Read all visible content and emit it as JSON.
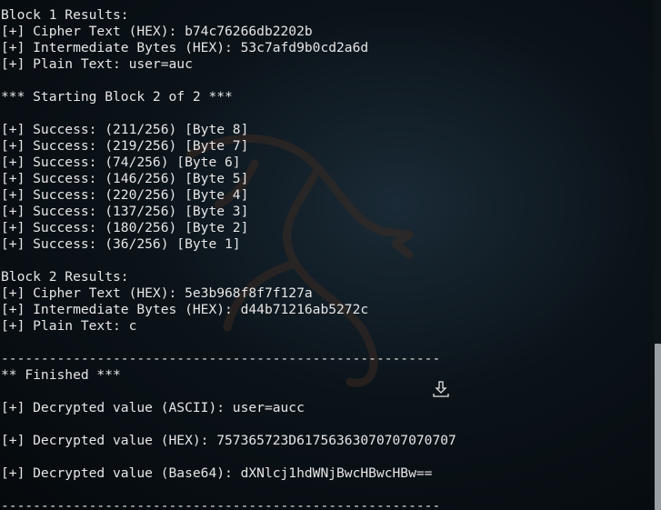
{
  "terminal": {
    "lines": [
      "Block 1 Results:",
      "[+] Cipher Text (HEX): b74c76266db2202b",
      "[+] Intermediate Bytes (HEX): 53c7afd9b0cd2a6d",
      "[+] Plain Text: user=auc",
      "",
      "*** Starting Block 2 of 2 ***",
      "",
      "[+] Success: (211/256) [Byte 8]",
      "[+] Success: (219/256) [Byte 7]",
      "[+] Success: (74/256) [Byte 6]",
      "[+] Success: (146/256) [Byte 5]",
      "[+] Success: (220/256) [Byte 4]",
      "[+] Success: (137/256) [Byte 3]",
      "[+] Success: (180/256) [Byte 2]",
      "[+] Success: (36/256) [Byte 1]",
      "",
      "Block 2 Results:",
      "[+] Cipher Text (HEX): 5e3b968f8f7f127a",
      "[+] Intermediate Bytes (HEX): d44b71216ab5272c",
      "[+] Plain Text: c",
      "",
      "-------------------------------------------------------",
      "** Finished ***",
      "",
      "[+] Decrypted value (ASCII): user=aucc",
      "",
      "[+] Decrypted value (HEX): 757365723D61756363070707070707",
      "",
      "[+] Decrypted value (Base64): dXNlcj1hdWNjBwcHBwcHBw==",
      "",
      "-------------------------------------------------------"
    ]
  },
  "icons": {
    "background": "kali-dragon-icon",
    "overlay": "download-icon"
  },
  "colors": {
    "text": "#e6e6e6",
    "background": "#0b1319",
    "scroll_thumb": "#9aa0a3"
  }
}
